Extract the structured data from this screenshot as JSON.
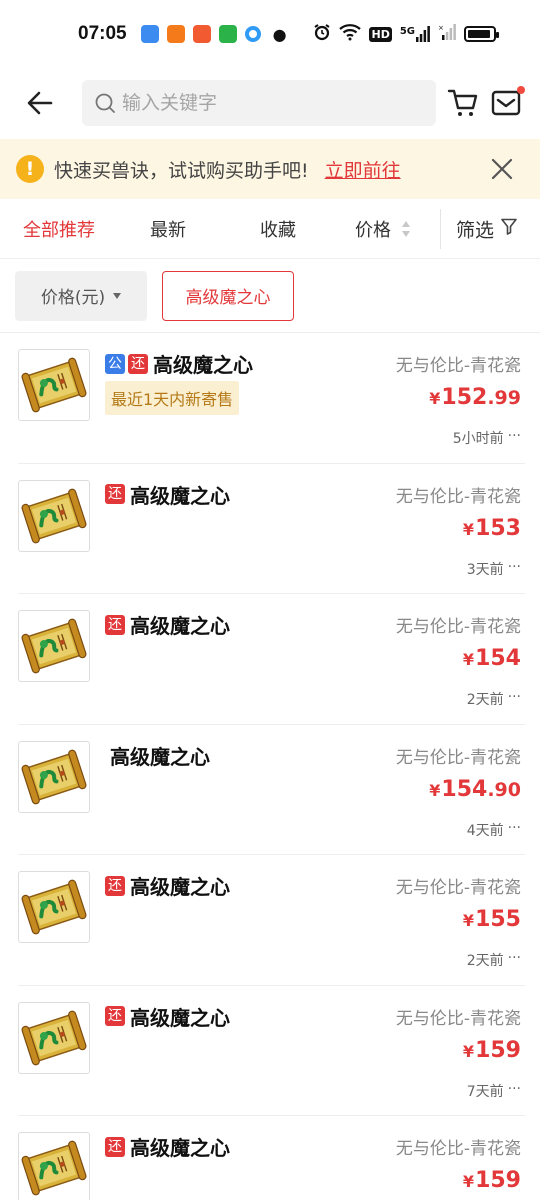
{
  "status_bar": {
    "time": "07:05",
    "network": "5G",
    "hd": "HD"
  },
  "header": {
    "search_placeholder": "输入关键字"
  },
  "banner": {
    "text": "快速买兽诀，试试购买助手吧!",
    "link": "立即前往"
  },
  "tabs": {
    "items": [
      {
        "label": "全部推荐",
        "active": true
      },
      {
        "label": "最新"
      },
      {
        "label": "收藏"
      },
      {
        "label": "价格"
      }
    ],
    "filter_label": "筛选"
  },
  "chips": {
    "price_label": "价格(元)",
    "keyword": "高级魔之心"
  },
  "items": [
    {
      "badges": [
        "公",
        "还"
      ],
      "title": "高级魔之心",
      "tag": "最近1天内新寄售",
      "server": "无与伦比-青花瓷",
      "price_main": "152",
      "price_dec": ".99",
      "time": "5小时前"
    },
    {
      "badges": [
        "还"
      ],
      "title": "高级魔之心",
      "server": "无与伦比-青花瓷",
      "price_main": "153",
      "price_dec": "",
      "time": "3天前"
    },
    {
      "badges": [
        "还"
      ],
      "title": "高级魔之心",
      "server": "无与伦比-青花瓷",
      "price_main": "154",
      "price_dec": "",
      "time": "2天前"
    },
    {
      "badges": [],
      "title": "高级魔之心",
      "server": "无与伦比-青花瓷",
      "price_main": "154",
      "price_dec": ".90",
      "time": "4天前"
    },
    {
      "badges": [
        "还"
      ],
      "title": "高级魔之心",
      "server": "无与伦比-青花瓷",
      "price_main": "155",
      "price_dec": "",
      "time": "2天前"
    },
    {
      "badges": [
        "还"
      ],
      "title": "高级魔之心",
      "server": "无与伦比-青花瓷",
      "price_main": "159",
      "price_dec": "",
      "time": "7天前"
    },
    {
      "badges": [
        "还"
      ],
      "title": "高级魔之心",
      "server": "无与伦比-青花瓷",
      "price_main": "159",
      "price_dec": "",
      "time": ""
    }
  ],
  "currency_symbol": "¥",
  "more_glyph": "···",
  "colors": {
    "accent": "#e2383a",
    "badge_public": "#3a7de8",
    "banner_bg": "#fdf6e3",
    "tag_bg": "#fbefd2",
    "tag_text": "#b57a17"
  }
}
